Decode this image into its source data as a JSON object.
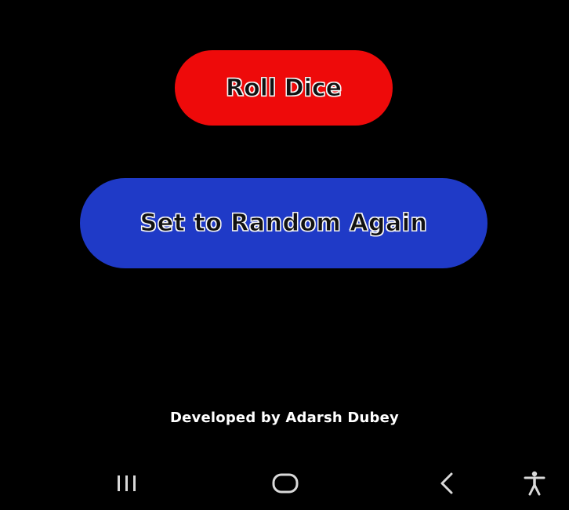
{
  "buttons": {
    "roll_label": "Roll Dice",
    "random_label": "Set to Random Again"
  },
  "footer": {
    "credit": "Developed by Adarsh Dubey"
  },
  "colors": {
    "background": "#000000",
    "roll_button": "#ee0a0a",
    "random_button": "#1f3ac7",
    "nav_icon": "#d9d9d9"
  },
  "navbar": {
    "icons": [
      "recents-icon",
      "home-icon",
      "back-icon",
      "accessibility-icon"
    ]
  }
}
